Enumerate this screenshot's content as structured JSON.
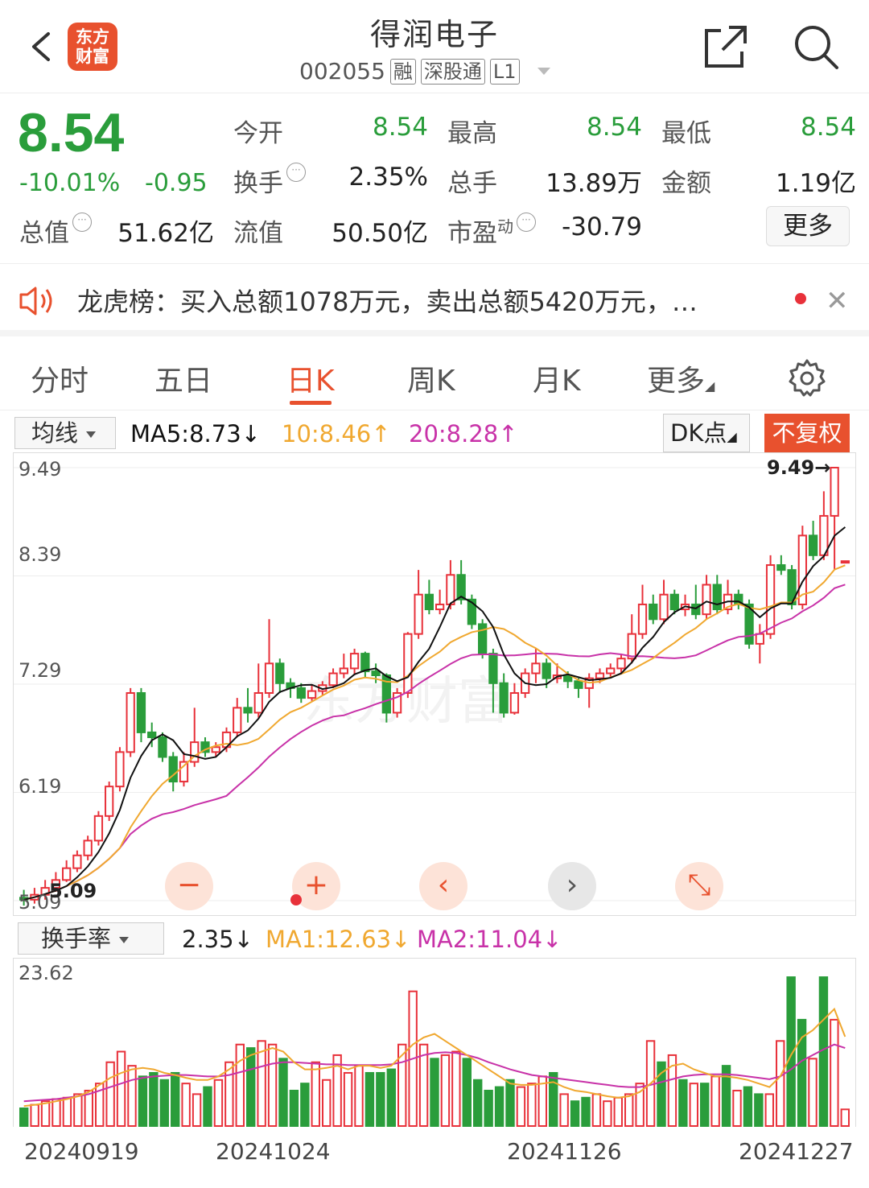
{
  "header": {
    "logo_text": "东方财富",
    "title": "得润电子",
    "code": "002055",
    "tags": [
      "融",
      "深股通",
      "L1"
    ]
  },
  "quote": {
    "price": "8.54",
    "change_pct": "-10.01%",
    "change": "-0.95",
    "fields": {
      "open_label": "今开",
      "open": "8.54",
      "high_label": "最高",
      "high": "8.54",
      "low_label": "最低",
      "low": "8.54",
      "turnover_label": "换手",
      "turnover": "2.35%",
      "volume_label": "总手",
      "volume": "13.89万",
      "amount_label": "金额",
      "amount": "1.19亿",
      "mktcap_label": "总值",
      "mktcap": "51.62亿",
      "float_label": "流值",
      "float": "50.50亿",
      "pe_label": "市盈",
      "pe_sup": "动",
      "pe": "-30.79"
    },
    "more_label": "更多"
  },
  "news": {
    "text": "龙虎榜：买入总额1078万元，卖出总额5420万元，…"
  },
  "tabs": [
    "分时",
    "五日",
    "日K",
    "周K",
    "月K",
    "更多"
  ],
  "active_tab": "日K",
  "ma_row": {
    "select_label": "均线",
    "ma5": "MA5:8.73↓",
    "ma10": "10:8.46↑",
    "ma20": "20:8.28↑",
    "dk_label": "DK点",
    "fq_label": "不复权"
  },
  "colors": {
    "up": "#e8313a",
    "down": "#2a9d3b",
    "ma5": "#111111",
    "ma10": "#f0a830",
    "ma20": "#c832a8",
    "accent": "#e8512e"
  },
  "chart_data": {
    "type": "candlestick",
    "y_ticks": [
      "9.49",
      "8.39",
      "7.29",
      "6.19",
      "5.09"
    ],
    "ylim": [
      5.09,
      9.49
    ],
    "max_marker": "9.49→",
    "min_marker": "5.09",
    "x_labels": [
      "20240919",
      "20241024",
      "20241126",
      "20241227"
    ],
    "candles": [
      [
        5.12,
        5.1,
        5.2,
        5.04
      ],
      [
        5.1,
        5.15,
        5.22,
        5.06
      ],
      [
        5.15,
        5.22,
        5.3,
        5.1
      ],
      [
        5.22,
        5.3,
        5.38,
        5.18
      ],
      [
        5.3,
        5.42,
        5.5,
        5.28
      ],
      [
        5.42,
        5.55,
        5.6,
        5.38
      ],
      [
        5.55,
        5.7,
        5.75,
        5.5
      ],
      [
        5.7,
        5.95,
        6.0,
        5.65
      ],
      [
        5.95,
        6.25,
        6.3,
        5.9
      ],
      [
        6.25,
        6.6,
        6.65,
        6.2
      ],
      [
        6.6,
        7.2,
        7.25,
        6.55
      ],
      [
        7.2,
        6.8,
        7.25,
        6.7
      ],
      [
        6.8,
        6.75,
        6.9,
        6.65
      ],
      [
        6.75,
        6.55,
        6.8,
        6.5
      ],
      [
        6.55,
        6.3,
        6.6,
        6.2
      ],
      [
        6.3,
        6.5,
        6.6,
        6.25
      ],
      [
        6.5,
        6.7,
        7.05,
        6.45
      ],
      [
        6.7,
        6.6,
        6.75,
        6.55
      ],
      [
        6.6,
        6.65,
        6.7,
        6.55
      ],
      [
        6.65,
        6.8,
        6.85,
        6.6
      ],
      [
        6.8,
        7.05,
        7.15,
        6.75
      ],
      [
        7.05,
        7.0,
        7.25,
        6.9
      ],
      [
        7.0,
        7.2,
        7.5,
        6.95
      ],
      [
        7.2,
        7.5,
        7.95,
        7.15
      ],
      [
        7.5,
        7.3,
        7.55,
        7.2
      ],
      [
        7.3,
        7.25,
        7.35,
        7.15
      ],
      [
        7.25,
        7.15,
        7.3,
        7.1
      ],
      [
        7.15,
        7.22,
        7.28,
        7.12
      ],
      [
        7.22,
        7.28,
        7.32,
        7.18
      ],
      [
        7.28,
        7.4,
        7.45,
        7.25
      ],
      [
        7.4,
        7.45,
        7.6,
        7.35
      ],
      [
        7.45,
        7.6,
        7.65,
        7.38
      ],
      [
        7.6,
        7.42,
        7.62,
        7.35
      ],
      [
        7.42,
        7.38,
        7.5,
        7.3
      ],
      [
        7.38,
        7.0,
        7.4,
        6.9
      ],
      [
        7.0,
        7.2,
        7.25,
        6.95
      ],
      [
        7.2,
        7.8,
        7.82,
        7.15
      ],
      [
        7.8,
        8.2,
        8.45,
        7.75
      ],
      [
        8.2,
        8.05,
        8.35,
        8.0
      ],
      [
        8.05,
        8.1,
        8.25,
        8.0
      ],
      [
        8.1,
        8.4,
        8.55,
        8.05
      ],
      [
        8.4,
        8.15,
        8.55,
        8.1
      ],
      [
        8.15,
        7.9,
        8.2,
        7.85
      ],
      [
        7.9,
        7.6,
        7.95,
        7.55
      ],
      [
        7.6,
        7.3,
        7.65,
        7.0
      ],
      [
        7.3,
        7.0,
        7.4,
        6.95
      ],
      [
        7.0,
        7.2,
        7.3,
        6.98
      ],
      [
        7.2,
        7.4,
        7.45,
        7.15
      ],
      [
        7.4,
        7.5,
        7.65,
        7.3
      ],
      [
        7.5,
        7.35,
        7.55,
        7.25
      ],
      [
        7.35,
        7.38,
        7.5,
        7.3
      ],
      [
        7.38,
        7.32,
        7.42,
        7.25
      ],
      [
        7.32,
        7.25,
        7.35,
        7.15
      ],
      [
        7.25,
        7.35,
        7.4,
        7.05
      ],
      [
        7.35,
        7.4,
        7.45,
        7.3
      ],
      [
        7.4,
        7.45,
        7.5,
        7.35
      ],
      [
        7.45,
        7.55,
        7.6,
        7.4
      ],
      [
        7.55,
        7.8,
        8.0,
        7.5
      ],
      [
        7.8,
        8.1,
        8.3,
        7.75
      ],
      [
        8.1,
        7.95,
        8.2,
        7.9
      ],
      [
        7.95,
        8.2,
        8.35,
        7.9
      ],
      [
        8.2,
        8.05,
        8.25,
        8.0
      ],
      [
        8.05,
        8.1,
        8.2,
        7.98
      ],
      [
        8.1,
        8.0,
        8.3,
        7.95
      ],
      [
        8.0,
        8.3,
        8.4,
        7.95
      ],
      [
        8.3,
        8.05,
        8.4,
        8.0
      ],
      [
        8.05,
        8.2,
        8.35,
        8.0
      ],
      [
        8.2,
        8.1,
        8.25,
        8.05
      ],
      [
        8.1,
        7.7,
        8.15,
        7.65
      ],
      [
        7.7,
        7.8,
        7.9,
        7.5
      ],
      [
        7.8,
        8.5,
        8.6,
        7.75
      ],
      [
        8.5,
        8.45,
        8.6,
        8.4
      ],
      [
        8.45,
        8.1,
        8.5,
        8.05
      ],
      [
        8.1,
        8.8,
        8.9,
        8.05
      ],
      [
        8.8,
        8.6,
        8.95,
        8.55
      ],
      [
        8.6,
        9.0,
        9.25,
        8.55
      ],
      [
        9.0,
        9.49,
        9.49,
        8.45
      ],
      [
        8.54,
        8.54,
        8.54,
        8.54
      ]
    ]
  },
  "volume_row": {
    "select_label": "换手率",
    "value": "2.35↓",
    "ma1": "MA1:12.63↓",
    "ma2": "MA2:11.04↓"
  },
  "volume_chart": {
    "y_top": "23.62",
    "ymax": 23.62,
    "values": [
      2.5,
      3.0,
      3.5,
      3.8,
      4.0,
      4.5,
      5.0,
      6.0,
      9.0,
      10.5,
      8.5,
      7.0,
      7.5,
      6.5,
      7.5,
      6.0,
      4.5,
      5.5,
      6.5,
      9.0,
      11.5,
      11.0,
      12.0,
      11.5,
      9.5,
      5.0,
      6.0,
      9.0,
      6.5,
      10.0,
      7.5,
      8.5,
      7.5,
      7.5,
      8.0,
      11.5,
      19.0,
      11.5,
      9.5,
      10.0,
      10.5,
      9.5,
      6.5,
      5.0,
      5.5,
      6.5,
      5.5,
      6.0,
      7.0,
      7.5,
      4.5,
      3.5,
      4.0,
      4.5,
      3.5,
      4.0,
      4.5,
      6.0,
      12.0,
      9.0,
      10.0,
      6.5,
      6.0,
      6.0,
      7.0,
      8.5,
      5.0,
      5.5,
      4.5,
      4.5,
      12.0,
      21.0,
      15.0,
      9.5,
      21.0,
      15.0,
      2.35
    ],
    "ma1": [
      2.8,
      3.0,
      3.2,
      3.5,
      3.8,
      4.2,
      4.8,
      5.8,
      6.8,
      7.5,
      8.0,
      8.2,
      8.0,
      7.5,
      7.2,
      6.8,
      6.5,
      6.5,
      7.0,
      8.0,
      9.2,
      10.0,
      10.5,
      11.0,
      10.5,
      9.0,
      8.0,
      8.0,
      8.2,
      8.5,
      8.0,
      8.5,
      8.5,
      8.2,
      8.5,
      10.0,
      11.5,
      12.5,
      13.0,
      12.0,
      11.0,
      10.0,
      9.0,
      8.0,
      7.0,
      6.0,
      5.8,
      5.8,
      6.0,
      6.2,
      5.5,
      5.0,
      4.8,
      4.5,
      4.2,
      4.0,
      4.2,
      4.8,
      6.0,
      7.5,
      8.5,
      8.8,
      8.0,
      7.5,
      7.0,
      7.0,
      6.8,
      6.5,
      6.0,
      5.5,
      7.0,
      10.0,
      12.5,
      13.5,
      15.0,
      16.5,
      12.6
    ],
    "ma2": [
      3.5,
      3.6,
      3.7,
      3.8,
      4.0,
      4.2,
      4.5,
      5.0,
      5.5,
      6.0,
      6.5,
      6.8,
      7.0,
      7.1,
      7.2,
      7.2,
      7.1,
      7.0,
      7.0,
      7.2,
      7.6,
      8.0,
      8.4,
      8.8,
      9.0,
      9.0,
      8.9,
      8.8,
      8.7,
      8.7,
      8.6,
      8.6,
      8.6,
      8.6,
      8.7,
      9.0,
      9.5,
      10.0,
      10.3,
      10.4,
      10.3,
      10.0,
      9.6,
      9.0,
      8.5,
      8.0,
      7.6,
      7.2,
      7.0,
      6.8,
      6.6,
      6.4,
      6.2,
      6.0,
      5.8,
      5.6,
      5.5,
      5.5,
      5.8,
      6.2,
      6.6,
      7.0,
      7.2,
      7.3,
      7.3,
      7.3,
      7.2,
      7.0,
      6.8,
      6.6,
      7.0,
      8.0,
      9.2,
      10.0,
      10.8,
      11.5,
      11.0
    ]
  },
  "zoom_controls": [
    "−",
    "+",
    "‹",
    "›",
    "⤡"
  ]
}
